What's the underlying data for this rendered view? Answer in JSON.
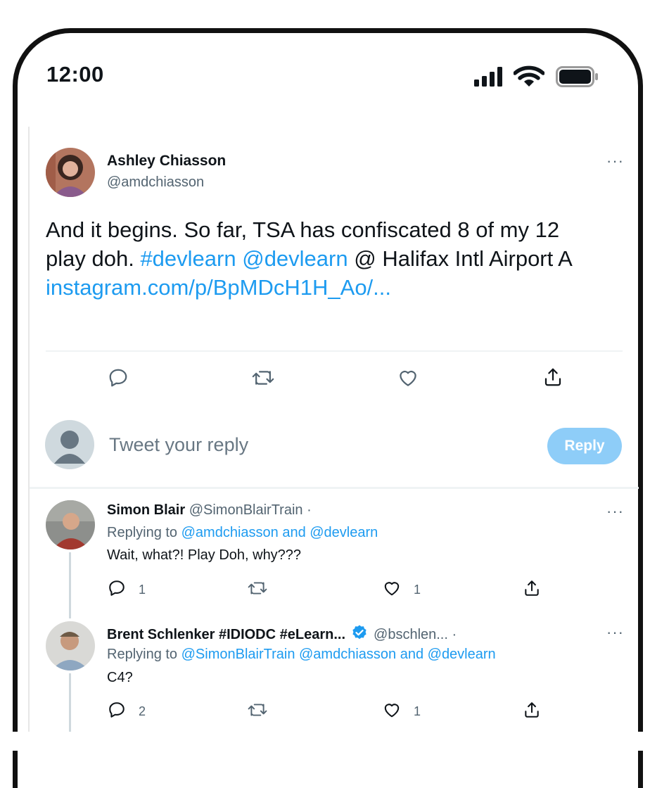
{
  "status_bar": {
    "time": "12:00",
    "icons": [
      "cellular-signal-icon",
      "wifi-icon",
      "battery-icon"
    ]
  },
  "tweet": {
    "author_name": "Ashley Chiasson",
    "author_handle": "@amdchiasson",
    "more": "···",
    "text_part1": "And it begins. So far, TSA has confiscated 8 of my 12",
    "text_part2": "play doh. ",
    "hashtag": "#devlearn",
    "mention": "@devlearn",
    "text_part3": "@ Halifax Intl Airport A",
    "link": "instagram.com/p/BpMDcH1H_Ao/...",
    "actions": [
      "reply-icon",
      "retweet-icon",
      "like-icon",
      "share-icon"
    ]
  },
  "composer": {
    "placeholder": "Tweet your reply",
    "reply_label": "Reply"
  },
  "replies": [
    {
      "author_name": "Simon Blair",
      "author_handle": "@SimonBlairTrain ·",
      "replying_prefix": "Replying to ",
      "replying_to": "@amdchiasson and @devlearn",
      "text": "Wait, what?! Play Doh, why???",
      "reply_count": "1",
      "like_count": "1",
      "more": "···"
    },
    {
      "author_name": "Brent Schlenker #IDIODC #eLearn...",
      "author_handle": "@bschlen... ·",
      "verified": true,
      "replying_prefix": "Replying to ",
      "replying_to": "@SimonBlairTrain @amdchiasson and @devlearn",
      "text": "C4?",
      "reply_count": "2",
      "like_count": "1",
      "more": "···"
    }
  ],
  "colors": {
    "link": "#1d9bf0",
    "reply_button": "#8ecdf8",
    "secondary_text": "#536471",
    "divider": "#eff3f4"
  }
}
